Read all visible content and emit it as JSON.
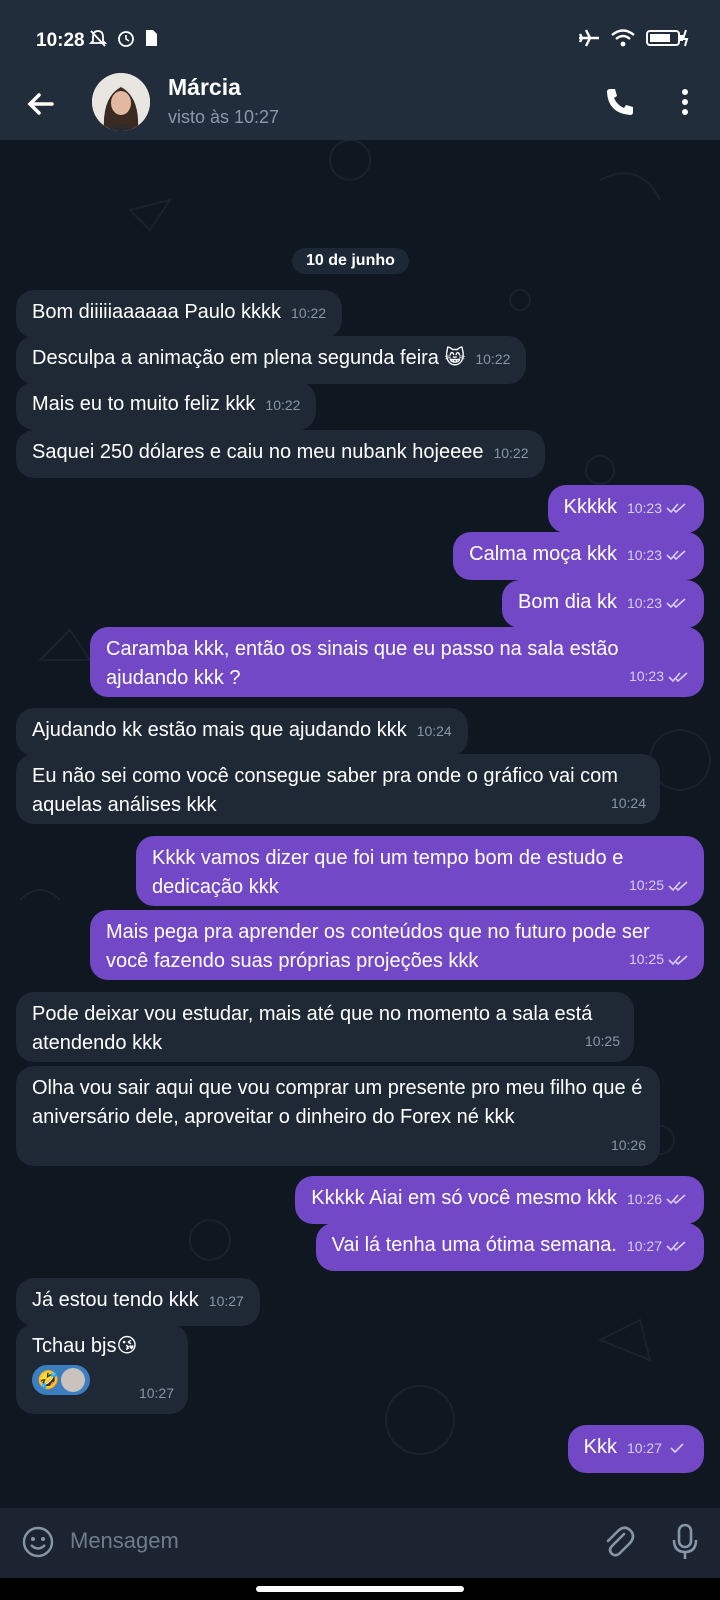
{
  "status_bar": {
    "time": "10:28"
  },
  "header": {
    "contact_name": "Márcia",
    "contact_status": "visto às 10:27"
  },
  "chat": {
    "date_label": "10 de junho",
    "messages": [
      {
        "dir": "in",
        "text": "Bom diiiiiaaaaaa Paulo kkkk",
        "time": "10:22"
      },
      {
        "dir": "in",
        "text": "Desculpa a animação em plena segunda feira 😸",
        "time": "10:22"
      },
      {
        "dir": "in",
        "text": "Mais eu to muito feliz kkk",
        "time": "10:22"
      },
      {
        "dir": "in",
        "text": "Saquei 250 dólares e caiu no meu nubank hojeeee",
        "time": "10:22"
      },
      {
        "dir": "out",
        "text": "Kkkkk",
        "time": "10:23"
      },
      {
        "dir": "out",
        "text": "Calma moça kkk",
        "time": "10:23"
      },
      {
        "dir": "out",
        "text": "Bom dia kk",
        "time": "10:23"
      },
      {
        "dir": "out",
        "text": "Caramba kkk, então os sinais que eu passo na sala estão ajudando kkk ?",
        "time": "10:23"
      },
      {
        "dir": "in",
        "text": "Ajudando kk estão mais que ajudando kkk",
        "time": "10:24"
      },
      {
        "dir": "in",
        "text": "Eu não sei como você consegue saber pra onde o gráfico vai com aquelas análises kkk",
        "time": "10:24"
      },
      {
        "dir": "out",
        "text": "Kkkk vamos dizer que foi um tempo bom de estudo e dedicação kkk",
        "time": "10:25"
      },
      {
        "dir": "out",
        "text": "Mais pega pra aprender os conteúdos que no futuro pode ser você fazendo suas próprias projeções kkk",
        "time": "10:25"
      },
      {
        "dir": "in",
        "text": "Pode deixar vou estudar, mais até que no momento a sala está atendendo kkk",
        "time": "10:25"
      },
      {
        "dir": "in",
        "text": "Olha vou sair aqui que vou comprar um presente pro meu filho que é aniversário dele, aproveitar o dinheiro do Forex né kkk",
        "time": "10:26"
      },
      {
        "dir": "out",
        "text": "Kkkkk Aiai em só você mesmo kkk",
        "time": "10:26"
      },
      {
        "dir": "out",
        "text": "Vai lá tenha uma ótima semana.",
        "time": "10:27"
      },
      {
        "dir": "in",
        "text": "Já estou tendo kkk",
        "time": "10:27"
      },
      {
        "dir": "in",
        "text": "Tchau bjs😘",
        "time": "10:27",
        "reaction": "🤣"
      },
      {
        "dir": "out",
        "text": "Kkk",
        "time": "10:27"
      }
    ]
  },
  "input": {
    "placeholder": "Mensagem"
  },
  "colors": {
    "outgoing_bubble": "#7248c7",
    "incoming_bubble": "#1f2936",
    "header": "#212d3b"
  }
}
